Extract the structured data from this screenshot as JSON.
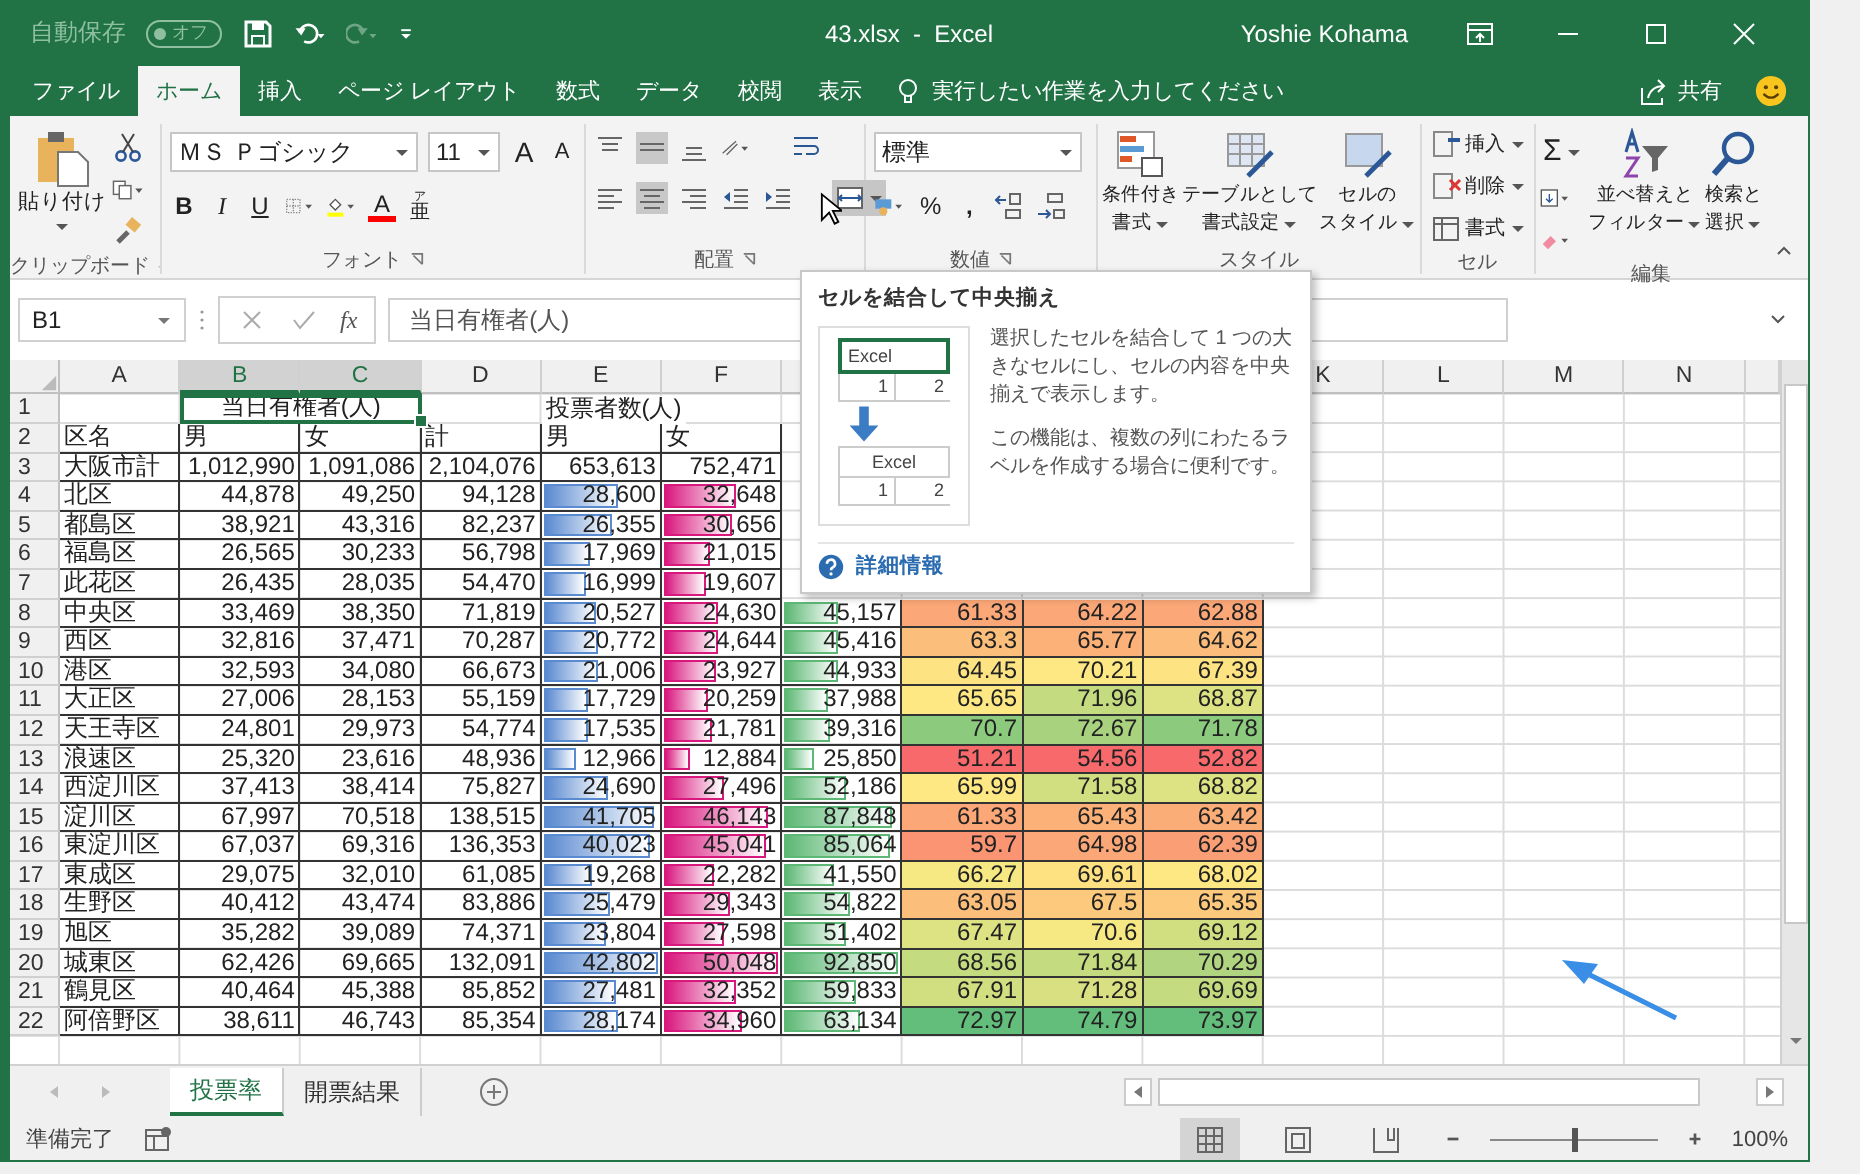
{
  "title_bar": {
    "autosave_label": "自動保存",
    "autosave_toggle": {
      "label": "オフ",
      "on": false
    },
    "document_title": "43.xlsx  -  Excel",
    "user_name": "Yoshie Kohama"
  },
  "tabs": [
    {
      "label": "ファイル",
      "selected": false
    },
    {
      "label": "ホーム",
      "selected": true
    },
    {
      "label": "挿入",
      "selected": false
    },
    {
      "label": "ページ レイアウト",
      "selected": false
    },
    {
      "label": "数式",
      "selected": false
    },
    {
      "label": "データ",
      "selected": false
    },
    {
      "label": "校閲",
      "selected": false
    },
    {
      "label": "表示",
      "selected": false
    }
  ],
  "tell_me": {
    "placeholder": "実行したい作業を入力してください"
  },
  "share_label": "共有",
  "ribbon": {
    "clipboard": {
      "paste_label": "貼り付け",
      "group_label": "クリップボード"
    },
    "font": {
      "name": "ＭＳ Ｐゴシック",
      "size": "11",
      "grow": "A",
      "shrink": "A",
      "bold": "B",
      "italic": "I",
      "underline": "U",
      "font_color": "A",
      "phonetic_top": "ア",
      "phonetic_main": "亜",
      "group_label": "フォント"
    },
    "alignment": {
      "merge_highlighted": true,
      "group_label": "配置"
    },
    "number": {
      "format": "標準",
      "percent": "%",
      "comma": ",",
      "group_label": "数値"
    },
    "styles": {
      "buttons": [
        {
          "kind": "conditional",
          "line1": "条件付き",
          "line2": "書式"
        },
        {
          "kind": "table",
          "line1": "テーブルとして",
          "line2": "書式設定"
        },
        {
          "kind": "cellstyle",
          "line1": "セルの",
          "line2": "スタイル"
        }
      ],
      "group_label": "スタイル"
    },
    "cells": {
      "buttons": [
        {
          "kind": "insert",
          "label": "挿入"
        },
        {
          "kind": "delete",
          "label": "削除"
        },
        {
          "kind": "format",
          "label": "書式"
        }
      ],
      "group_label": "セル"
    },
    "editing": {
      "sum": "Σ",
      "buttons": [
        {
          "kind": "sort",
          "line1": "並べ替えと",
          "line2": "フィルター"
        },
        {
          "kind": "find",
          "line1": "検索と",
          "line2": "選択"
        }
      ],
      "group_label": "編集"
    }
  },
  "formula_bar": {
    "name_box": "B1",
    "fx": "fx",
    "formula": "当日有権者(人)"
  },
  "grid": {
    "columns": [
      {
        "label": "A",
        "selected": false
      },
      {
        "label": "B",
        "selected": true
      },
      {
        "label": "C",
        "selected": true
      },
      {
        "label": "D",
        "selected": false
      },
      {
        "label": "E",
        "selected": false,
        "color": "#5a8ad0"
      },
      {
        "label": "F",
        "selected": false,
        "color": "#d9187e"
      },
      {
        "color": "#5cb874"
      },
      {},
      {},
      {},
      {
        "label": "K",
        "selected": false
      },
      {
        "label": "L",
        "selected": false
      },
      {
        "label": "M",
        "selected": false
      },
      {
        "label": "N",
        "selected": false
      }
    ],
    "rows": [
      {
        "num": "1",
        "cells": [
          "",
          {
            "kind": "merged",
            "text": "当日有権者(人)",
            "selected": true
          },
          "",
          "",
          {
            "kind": "spill",
            "text": "投票者数(人)"
          },
          "",
          "",
          "",
          "",
          ""
        ]
      },
      {
        "num": "2",
        "cells": [
          {
            "kind": "text",
            "text": "区名"
          },
          {
            "kind": "text",
            "text": "男"
          },
          {
            "kind": "text",
            "text": "女"
          },
          {
            "kind": "text",
            "text": "計"
          },
          {
            "kind": "text",
            "text": "男"
          },
          {
            "kind": "text",
            "text": "女"
          },
          "",
          "",
          "",
          ""
        ]
      },
      {
        "num": "3",
        "cells": [
          {
            "kind": "text",
            "text": "大阪市計"
          },
          {
            "kind": "num",
            "text": "1,012,990"
          },
          {
            "kind": "num",
            "text": "1,091,086"
          },
          {
            "kind": "num",
            "text": "2,104,076"
          },
          {
            "kind": "num",
            "text": "653,613"
          },
          {
            "kind": "num",
            "text": "752,471"
          },
          "",
          "",
          "",
          ""
        ]
      },
      {
        "num": "4",
        "cells": [
          {
            "kind": "text",
            "text": "北区"
          },
          {
            "kind": "num",
            "text": "44,878"
          },
          {
            "kind": "num",
            "text": "49,250"
          },
          {
            "kind": "num",
            "text": "94,128"
          },
          {
            "kind": "bar",
            "text": "28,600",
            "level": 0.67
          },
          {
            "kind": "bar",
            "text": "32,648",
            "level": 0.65
          },
          "",
          "",
          "",
          ""
        ]
      },
      {
        "num": "5",
        "cells": [
          {
            "kind": "text",
            "text": "都島区"
          },
          {
            "kind": "num",
            "text": "38,921"
          },
          {
            "kind": "num",
            "text": "43,316"
          },
          {
            "kind": "num",
            "text": "82,237"
          },
          {
            "kind": "bar",
            "text": "26,355",
            "level": 0.62
          },
          {
            "kind": "bar",
            "text": "30,656",
            "level": 0.61
          },
          "",
          "",
          "",
          ""
        ]
      },
      {
        "num": "6",
        "cells": [
          {
            "kind": "text",
            "text": "福島区"
          },
          {
            "kind": "num",
            "text": "26,565"
          },
          {
            "kind": "num",
            "text": "30,233"
          },
          {
            "kind": "num",
            "text": "56,798"
          },
          {
            "kind": "bar",
            "text": "17,969",
            "level": 0.42
          },
          {
            "kind": "bar",
            "text": "21,015",
            "level": 0.42
          },
          "",
          "",
          "",
          ""
        ]
      },
      {
        "num": "7",
        "cells": [
          {
            "kind": "text",
            "text": "此花区"
          },
          {
            "kind": "num",
            "text": "26,435"
          },
          {
            "kind": "num",
            "text": "28,035"
          },
          {
            "kind": "num",
            "text": "54,470"
          },
          {
            "kind": "bar",
            "text": "16,999",
            "level": 0.4
          },
          {
            "kind": "bar",
            "text": "19,607",
            "level": 0.39
          },
          "",
          "",
          "",
          ""
        ]
      },
      {
        "num": "8",
        "cells": [
          {
            "kind": "text",
            "text": "中央区"
          },
          {
            "kind": "num",
            "text": "33,469"
          },
          {
            "kind": "num",
            "text": "38,350"
          },
          {
            "kind": "num",
            "text": "71,819"
          },
          {
            "kind": "bar",
            "text": "20,527",
            "level": 0.48
          },
          {
            "kind": "bar",
            "text": "24,630",
            "level": 0.49
          },
          {
            "kind": "bar",
            "text": "45,157",
            "level": 0.49
          },
          {
            "kind": "scale",
            "text": "61.33",
            "color": "#fba777"
          },
          {
            "kind": "scale",
            "text": "64.22",
            "color": "#fba777"
          },
          {
            "kind": "scale",
            "text": "62.88",
            "color": "#fba777"
          }
        ]
      },
      {
        "num": "9",
        "cells": [
          {
            "kind": "text",
            "text": "西区"
          },
          {
            "kind": "num",
            "text": "32,816"
          },
          {
            "kind": "num",
            "text": "37,471"
          },
          {
            "kind": "num",
            "text": "70,287"
          },
          {
            "kind": "bar",
            "text": "20,772",
            "level": 0.49
          },
          {
            "kind": "bar",
            "text": "24,644",
            "level": 0.49
          },
          {
            "kind": "bar",
            "text": "45,416",
            "level": 0.49
          },
          {
            "kind": "scale",
            "text": "63.3",
            "color": "#fcbf7b"
          },
          {
            "kind": "scale",
            "text": "65.77",
            "color": "#fcb179"
          },
          {
            "kind": "scale",
            "text": "64.62",
            "color": "#fcbc7b"
          }
        ]
      },
      {
        "num": "10",
        "cells": [
          {
            "kind": "text",
            "text": "港区"
          },
          {
            "kind": "num",
            "text": "32,593"
          },
          {
            "kind": "num",
            "text": "34,080"
          },
          {
            "kind": "num",
            "text": "66,673"
          },
          {
            "kind": "bar",
            "text": "21,006",
            "level": 0.49
          },
          {
            "kind": "bar",
            "text": "23,927",
            "level": 0.48
          },
          {
            "kind": "bar",
            "text": "44,933",
            "level": 0.48
          },
          {
            "kind": "scale",
            "text": "64.45",
            "color": "#fde382"
          },
          {
            "kind": "scale",
            "text": "70.21",
            "color": "#fee883"
          },
          {
            "kind": "scale",
            "text": "67.39",
            "color": "#fee382"
          }
        ]
      },
      {
        "num": "11",
        "cells": [
          {
            "kind": "text",
            "text": "大正区"
          },
          {
            "kind": "num",
            "text": "27,006"
          },
          {
            "kind": "num",
            "text": "28,153"
          },
          {
            "kind": "num",
            "text": "55,159"
          },
          {
            "kind": "bar",
            "text": "17,729",
            "level": 0.41
          },
          {
            "kind": "bar",
            "text": "20,259",
            "level": 0.4
          },
          {
            "kind": "bar",
            "text": "37,988",
            "level": 0.41
          },
          {
            "kind": "scale",
            "text": "65.65",
            "color": "#fee883"
          },
          {
            "kind": "scale",
            "text": "71.96",
            "color": "#c5db80"
          },
          {
            "kind": "scale",
            "text": "68.87",
            "color": "#dde283"
          }
        ]
      },
      {
        "num": "12",
        "cells": [
          {
            "kind": "text",
            "text": "天王寺区"
          },
          {
            "kind": "num",
            "text": "24,801"
          },
          {
            "kind": "num",
            "text": "29,973"
          },
          {
            "kind": "num",
            "text": "54,774"
          },
          {
            "kind": "bar",
            "text": "17,535",
            "level": 0.41
          },
          {
            "kind": "bar",
            "text": "21,781",
            "level": 0.44
          },
          {
            "kind": "bar",
            "text": "39,316",
            "level": 0.42
          },
          {
            "kind": "scale",
            "text": "70.7",
            "color": "#8ccb7e"
          },
          {
            "kind": "scale",
            "text": "72.67",
            "color": "#a9d27f"
          },
          {
            "kind": "scale",
            "text": "71.78",
            "color": "#8ccb7e"
          }
        ]
      },
      {
        "num": "13",
        "cells": [
          {
            "kind": "text",
            "text": "浪速区"
          },
          {
            "kind": "num",
            "text": "25,320"
          },
          {
            "kind": "num",
            "text": "23,616"
          },
          {
            "kind": "num",
            "text": "48,936"
          },
          {
            "kind": "bar",
            "text": "12,966",
            "level": 0.3
          },
          {
            "kind": "bar",
            "text": "12,884",
            "level": 0.26
          },
          {
            "kind": "bar",
            "text": "25,850",
            "level": 0.28
          },
          {
            "kind": "scale",
            "text": "51.21",
            "color": "#f8696b"
          },
          {
            "kind": "scale",
            "text": "54.56",
            "color": "#f8696b"
          },
          {
            "kind": "scale",
            "text": "52.82",
            "color": "#f8696b"
          }
        ]
      },
      {
        "num": "14",
        "cells": [
          {
            "kind": "text",
            "text": "西淀川区"
          },
          {
            "kind": "num",
            "text": "37,413"
          },
          {
            "kind": "num",
            "text": "38,414"
          },
          {
            "kind": "num",
            "text": "75,827"
          },
          {
            "kind": "bar",
            "text": "24,690",
            "level": 0.58
          },
          {
            "kind": "bar",
            "text": "27,496",
            "level": 0.55
          },
          {
            "kind": "bar",
            "text": "52,186",
            "level": 0.56
          },
          {
            "kind": "scale",
            "text": "65.99",
            "color": "#fee883"
          },
          {
            "kind": "scale",
            "text": "71.58",
            "color": "#d2df81"
          },
          {
            "kind": "scale",
            "text": "68.82",
            "color": "#dde283"
          }
        ]
      },
      {
        "num": "15",
        "cells": [
          {
            "kind": "text",
            "text": "淀川区"
          },
          {
            "kind": "num",
            "text": "67,997"
          },
          {
            "kind": "num",
            "text": "70,518"
          },
          {
            "kind": "num",
            "text": "138,515"
          },
          {
            "kind": "bar",
            "text": "41,705",
            "level": 0.97
          },
          {
            "kind": "bar",
            "text": "46,143",
            "level": 0.92
          },
          {
            "kind": "bar",
            "text": "87,848",
            "level": 0.95
          },
          {
            "kind": "scale",
            "text": "61.33",
            "color": "#fba777"
          },
          {
            "kind": "scale",
            "text": "65.43",
            "color": "#fcb179"
          },
          {
            "kind": "scale",
            "text": "63.42",
            "color": "#fbad78"
          }
        ]
      },
      {
        "num": "16",
        "cells": [
          {
            "kind": "text",
            "text": "東淀川区"
          },
          {
            "kind": "num",
            "text": "67,037"
          },
          {
            "kind": "num",
            "text": "69,316"
          },
          {
            "kind": "num",
            "text": "136,353"
          },
          {
            "kind": "bar",
            "text": "40,023",
            "level": 0.94
          },
          {
            "kind": "bar",
            "text": "45,041",
            "level": 0.9
          },
          {
            "kind": "bar",
            "text": "85,064",
            "level": 0.92
          },
          {
            "kind": "scale",
            "text": "59.7",
            "color": "#fa9473"
          },
          {
            "kind": "scale",
            "text": "64.98",
            "color": "#fba777"
          },
          {
            "kind": "scale",
            "text": "62.39",
            "color": "#fa9f75"
          }
        ]
      },
      {
        "num": "17",
        "cells": [
          {
            "kind": "text",
            "text": "東成区"
          },
          {
            "kind": "num",
            "text": "29,075"
          },
          {
            "kind": "num",
            "text": "32,010"
          },
          {
            "kind": "num",
            "text": "61,085"
          },
          {
            "kind": "bar",
            "text": "19,268",
            "level": 0.45
          },
          {
            "kind": "bar",
            "text": "22,282",
            "level": 0.45
          },
          {
            "kind": "bar",
            "text": "41,550",
            "level": 0.45
          },
          {
            "kind": "scale",
            "text": "66.27",
            "color": "#f6e883"
          },
          {
            "kind": "scale",
            "text": "69.61",
            "color": "#fee282"
          },
          {
            "kind": "scale",
            "text": "68.02",
            "color": "#fee883"
          }
        ]
      },
      {
        "num": "18",
        "cells": [
          {
            "kind": "text",
            "text": "生野区"
          },
          {
            "kind": "num",
            "text": "40,412"
          },
          {
            "kind": "num",
            "text": "43,474"
          },
          {
            "kind": "num",
            "text": "83,886"
          },
          {
            "kind": "bar",
            "text": "25,479",
            "level": 0.6
          },
          {
            "kind": "bar",
            "text": "29,343",
            "level": 0.59
          },
          {
            "kind": "bar",
            "text": "54,822",
            "level": 0.59
          },
          {
            "kind": "scale",
            "text": "63.05",
            "color": "#fcbf7b"
          },
          {
            "kind": "scale",
            "text": "67.5",
            "color": "#fdc97d"
          },
          {
            "kind": "scale",
            "text": "65.35",
            "color": "#fdc97d"
          }
        ]
      },
      {
        "num": "19",
        "cells": [
          {
            "kind": "text",
            "text": "旭区"
          },
          {
            "kind": "num",
            "text": "35,282"
          },
          {
            "kind": "num",
            "text": "39,089"
          },
          {
            "kind": "num",
            "text": "74,371"
          },
          {
            "kind": "bar",
            "text": "23,804",
            "level": 0.56
          },
          {
            "kind": "bar",
            "text": "27,598",
            "level": 0.55
          },
          {
            "kind": "bar",
            "text": "51,402",
            "level": 0.55
          },
          {
            "kind": "scale",
            "text": "67.47",
            "color": "#dde283"
          },
          {
            "kind": "scale",
            "text": "70.6",
            "color": "#f6e883"
          },
          {
            "kind": "scale",
            "text": "69.12",
            "color": "#d2df81"
          }
        ]
      },
      {
        "num": "20",
        "cells": [
          {
            "kind": "text",
            "text": "城東区"
          },
          {
            "kind": "num",
            "text": "62,426"
          },
          {
            "kind": "num",
            "text": "69,665"
          },
          {
            "kind": "num",
            "text": "132,091"
          },
          {
            "kind": "bar",
            "text": "42,802",
            "level": 1.0
          },
          {
            "kind": "bar",
            "text": "50,048",
            "level": 1.0
          },
          {
            "kind": "bar",
            "text": "92,850",
            "level": 1.0
          },
          {
            "kind": "scale",
            "text": "68.56",
            "color": "#c5db80"
          },
          {
            "kind": "scale",
            "text": "71.84",
            "color": "#c5db80"
          },
          {
            "kind": "scale",
            "text": "70.29",
            "color": "#b0d47f"
          }
        ]
      },
      {
        "num": "21",
        "cells": [
          {
            "kind": "text",
            "text": "鶴見区"
          },
          {
            "kind": "num",
            "text": "40,464"
          },
          {
            "kind": "num",
            "text": "45,388"
          },
          {
            "kind": "num",
            "text": "85,852"
          },
          {
            "kind": "bar",
            "text": "27,481",
            "level": 0.64
          },
          {
            "kind": "bar",
            "text": "32,352",
            "level": 0.65
          },
          {
            "kind": "bar",
            "text": "59,833",
            "level": 0.64
          },
          {
            "kind": "scale",
            "text": "67.91",
            "color": "#d2df81"
          },
          {
            "kind": "scale",
            "text": "71.28",
            "color": "#d9e081"
          },
          {
            "kind": "scale",
            "text": "69.69",
            "color": "#c5db80"
          }
        ]
      },
      {
        "num": "22",
        "cells": [
          {
            "kind": "text",
            "text": "阿倍野区"
          },
          {
            "kind": "num",
            "text": "38,611"
          },
          {
            "kind": "num",
            "text": "46,743"
          },
          {
            "kind": "num",
            "text": "85,354"
          },
          {
            "kind": "bar",
            "text": "28,174",
            "level": 0.66
          },
          {
            "kind": "bar",
            "text": "34,960",
            "level": 0.7
          },
          {
            "kind": "bar",
            "text": "63,134",
            "level": 0.68
          },
          {
            "kind": "scale",
            "text": "72.97",
            "color": "#63be7b"
          },
          {
            "kind": "scale",
            "text": "74.79",
            "color": "#63be7b"
          },
          {
            "kind": "scale",
            "text": "73.97",
            "color": "#63be7b"
          }
        ]
      }
    ]
  },
  "tooltip": {
    "title": "セルを結合して中央揃え",
    "before": {
      "label": "Excel",
      "cells": [
        "1",
        "2"
      ]
    },
    "after": {
      "label": "Excel",
      "cells": [
        "1",
        "2"
      ]
    },
    "paragraphs": [
      "選択したセルを結合して 1 つの大きなセルにし、セルの内容を中央揃えで表示します。",
      "この機能は、複数の列にわたるラベルを作成する場合に便利です。"
    ],
    "link": "詳細情報"
  },
  "sheet_tabs": [
    {
      "label": "投票率",
      "selected": true
    },
    {
      "label": "開票結果",
      "selected": false
    }
  ],
  "status_bar": {
    "status": "準備完了",
    "views": [
      {
        "kind": "normal",
        "selected": true
      },
      {
        "kind": "layout",
        "selected": false
      },
      {
        "kind": "pagebreak",
        "selected": false
      }
    ],
    "zoom": {
      "level": 0.5
    },
    "zoom_label": "100%"
  }
}
